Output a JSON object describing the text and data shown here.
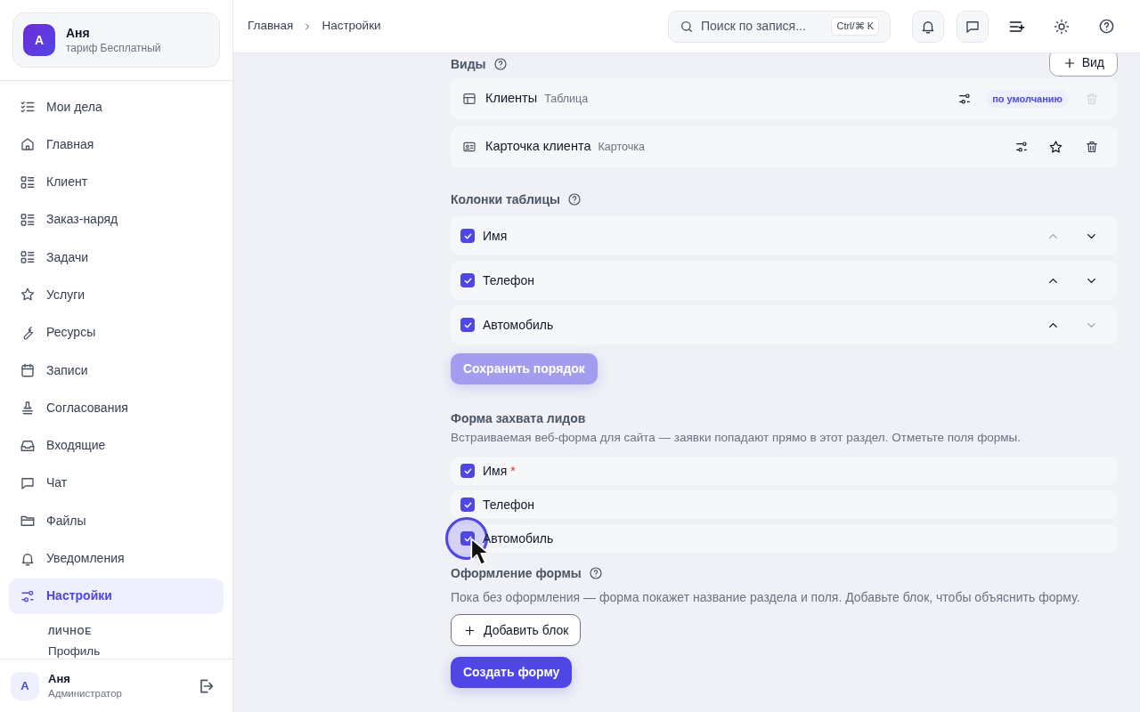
{
  "account": {
    "avatar": "А",
    "name": "Аня",
    "plan": "тариф Бесплатный"
  },
  "nav": [
    {
      "kind": "checklist",
      "label": "Мои дела",
      "selected": false
    },
    {
      "kind": "home",
      "label": "Главная",
      "selected": false
    },
    {
      "kind": "list",
      "label": "Клиент",
      "selected": false
    },
    {
      "kind": "list",
      "label": "Заказ-наряд",
      "selected": false
    },
    {
      "kind": "list",
      "label": "Задачи",
      "selected": false
    },
    {
      "kind": "star",
      "label": "Услуги",
      "selected": false
    },
    {
      "kind": "wrench",
      "label": "Ресурсы",
      "selected": false
    },
    {
      "kind": "calendar",
      "label": "Записи",
      "selected": false
    },
    {
      "kind": "stamp",
      "label": "Согласования",
      "selected": false
    },
    {
      "kind": "inbox",
      "label": "Входящие",
      "selected": false
    },
    {
      "kind": "chat",
      "label": "Чат",
      "selected": false
    },
    {
      "kind": "folder",
      "label": "Файлы",
      "selected": false
    },
    {
      "kind": "bell",
      "label": "Уведомления",
      "selected": false
    },
    {
      "kind": "sliders",
      "label": "Настройки",
      "selected": true
    }
  ],
  "nav_section": {
    "title": "ЛИЧНОЕ",
    "items": [
      "Профиль"
    ]
  },
  "user": {
    "avatar": "А",
    "name": "Аня",
    "role": "Администратор"
  },
  "breadcrumbs": [
    "Главная",
    "Настройки"
  ],
  "search": {
    "placeholder": "Поиск по запися...",
    "shortcut": "Ctrl/⌘ K"
  },
  "views": {
    "title": "Виды",
    "add_button": "Вид",
    "items": [
      {
        "kind": "table",
        "name": "Клиенты",
        "type": "Таблица",
        "default": true,
        "badge": "по умолчанию",
        "deletable": false
      },
      {
        "kind": "card",
        "name": "Карточка клиента",
        "type": "Карточка",
        "default": false,
        "deletable": true
      }
    ]
  },
  "columns": {
    "title": "Колонки таблицы",
    "items": [
      {
        "label": "Имя",
        "checked": true,
        "can_move_up": false,
        "can_move_down": true
      },
      {
        "label": "Телефон",
        "checked": true,
        "can_move_up": true,
        "can_move_down": true
      },
      {
        "label": "Автомобиль",
        "checked": true,
        "can_move_up": true,
        "can_move_down": false
      }
    ],
    "save_button": {
      "label": "Сохранить порядок",
      "disabled": true
    }
  },
  "lead_form": {
    "title": "Форма захвата лидов",
    "description": "Встраиваемая веб-форма для сайта — заявки попадают прямо в этот раздел. Отметьте поля формы.",
    "fields": [
      {
        "label": "Имя",
        "required_mark": "*",
        "checked": true,
        "focused": false
      },
      {
        "label": "Телефон",
        "checked": true,
        "focused": false
      },
      {
        "label": "Автомобиль",
        "checked": true,
        "focused": true
      }
    ]
  },
  "design": {
    "title": "Оформление формы",
    "description": "Пока без оформления — форма покажет название раздела и поля. Добавьте блок, чтобы объяснить форму.",
    "add_button": "Добавить блок",
    "create_button": "Создать форму"
  }
}
